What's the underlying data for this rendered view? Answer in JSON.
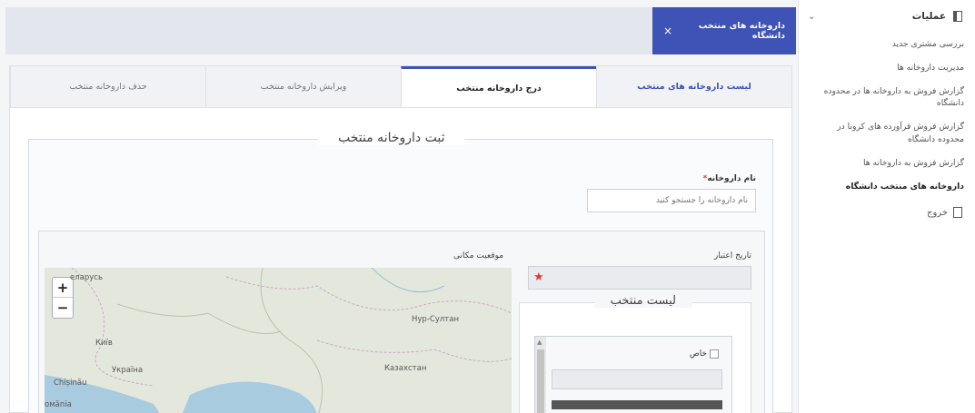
{
  "sidebar": {
    "section_title": "عملیات",
    "items": [
      {
        "label": "بررسی مشتری جدید"
      },
      {
        "label": "مدیریت داروخانه ها"
      },
      {
        "label": "گزارش فروش به داروخانه ها در محدوده دانشگاه"
      },
      {
        "label": "گزارش فروش فرآورده های کرونا در محدوده دانشگاه"
      },
      {
        "label": "گزارش فروش به داروخانه ها"
      },
      {
        "label": "داروخانه های منتخب دانشگاه"
      }
    ],
    "exit_label": "خروج"
  },
  "document_tab": {
    "label": "داروخانه های منتخب دانشگاه",
    "close_glyph": "×"
  },
  "tabs": [
    {
      "label": "لیست داروخانه های منتخب"
    },
    {
      "label": "درج داروخانه منتخب"
    },
    {
      "label": "ویرایش داروخانه منتخب"
    },
    {
      "label": "حذف داروخانه منتخب"
    }
  ],
  "form": {
    "legend": "ثبت داروخانه منتخب",
    "name_label": "نام داروخانه",
    "required_mark": "*",
    "name_placeholder": "نام داروخانه را جستجو کنید",
    "location_label": "موقعیت مکانی",
    "expiry_label": "تاریخ اعتبار",
    "expiry_required_mark": "★",
    "selected_list_legend": "لیست منتخب",
    "special_checkbox_label": "خاص"
  },
  "map": {
    "zoom_in": "+",
    "zoom_out": "−",
    "place_labels": [
      "Нур-Султан",
      "Казахстан",
      "Київ",
      "Україна",
      "Chișinău",
      "омānia",
      "елapусь"
    ]
  },
  "colors": {
    "accent": "#3f52b5",
    "required": "#e03c31"
  }
}
